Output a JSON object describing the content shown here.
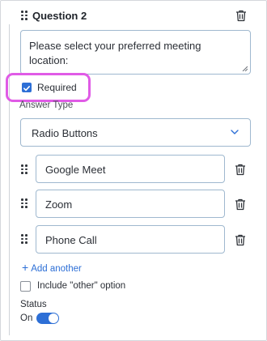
{
  "question": {
    "title": "Question 2",
    "prompt_value": "Please select your preferred meeting location:",
    "required_label": "Required",
    "required_checked": true
  },
  "answer_type": {
    "label": "Answer Type",
    "selected": "Radio Buttons"
  },
  "options": [
    {
      "value": "Google Meet"
    },
    {
      "value": "Zoom"
    },
    {
      "value": "Phone Call"
    }
  ],
  "add_another_label": "Add another",
  "include_other": {
    "label": "Include \"other\" option",
    "checked": false
  },
  "status": {
    "label": "Status",
    "value_label": "On",
    "enabled": true
  },
  "colors": {
    "accent": "#2d6fd6",
    "highlight": "#e05be6",
    "input_border": "#9fb8cf"
  },
  "icons": {
    "drag": "drag-handle-icon",
    "delete": "trash-icon",
    "dropdown": "chevron-down-icon",
    "add": "plus-icon",
    "check": "checkmark-icon"
  }
}
